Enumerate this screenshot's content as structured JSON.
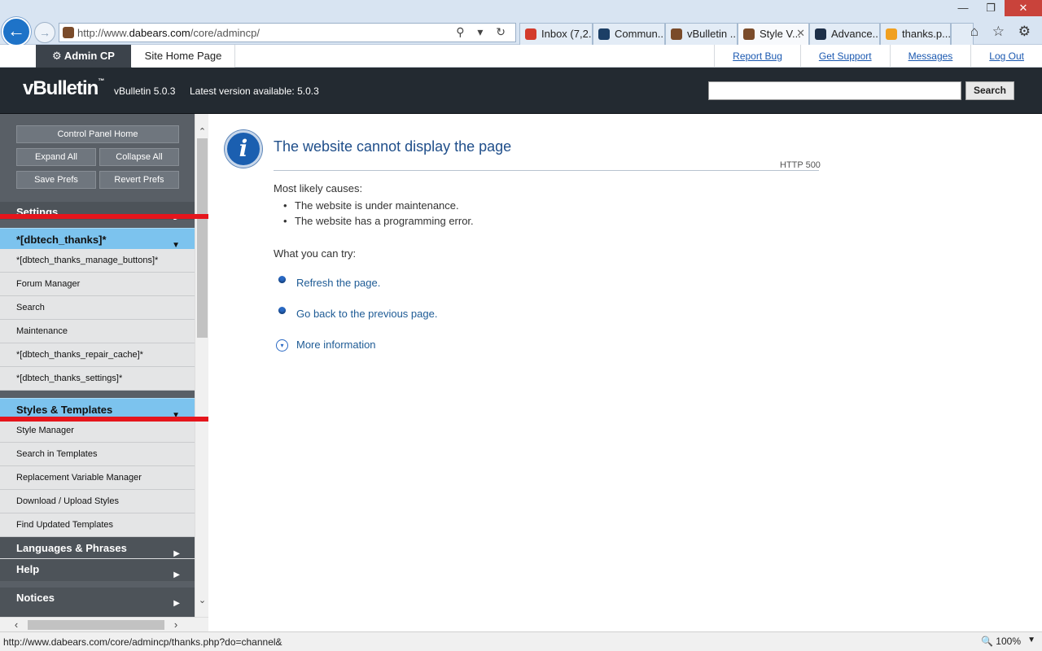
{
  "browser": {
    "url_prefix": "http://www.",
    "url_domain": "dabears.com",
    "url_path": "/core/admincp/",
    "tabs": [
      {
        "label": "Inbox (7,2...",
        "active": false,
        "icon_color": "#d33b2c"
      },
      {
        "label": "Commun...",
        "active": false,
        "icon_color": "#1c3f66"
      },
      {
        "label": "vBulletin ...",
        "active": false,
        "icon_color": "#7a4b2a"
      },
      {
        "label": "Style V...",
        "active": true,
        "icon_color": "#7a4b2a"
      },
      {
        "label": "Advance...",
        "active": false,
        "icon_color": "#1d2f48"
      },
      {
        "label": "thanks.p...",
        "active": false,
        "icon_color": "#f0a020"
      }
    ],
    "close_glyph": "✕",
    "back_glyph": "←",
    "fwd_glyph": "→",
    "address_tools": "⚲ ▾ ↻",
    "chrome_icons": "⌂ ☆ ⚙",
    "window_buttons": {
      "minimize": "—",
      "restore": "❐",
      "close": "✕"
    }
  },
  "topbar": {
    "admin_tab": "Admin CP",
    "admin_icon": "⚙",
    "site_tab": "Site Home Page",
    "links": [
      "Report Bug",
      "Get Support",
      "Messages",
      "Log Out"
    ]
  },
  "header": {
    "logo": "vBulletin",
    "logo_mark": "™",
    "version": "vBulletin 5.0.3",
    "latest": "Latest version available: 5.0.3",
    "search_button": "Search",
    "search_value": ""
  },
  "sidebar": {
    "buttons": {
      "home": "Control Panel Home",
      "expand": "Expand All",
      "collapse": "Collapse All",
      "save": "Save Prefs",
      "revert": "Revert Prefs"
    },
    "settings_group": "Settings",
    "thanks_group": "*[dbtech_thanks]*",
    "thanks_items": [
      "*[dbtech_thanks_manage_buttons]*",
      "Forum Manager",
      "Search",
      "Maintenance",
      "*[dbtech_thanks_repair_cache]*",
      "*[dbtech_thanks_settings]*"
    ],
    "styles_group": "Styles & Templates",
    "styles_items": [
      "Style Manager",
      "Search in Templates",
      "Replacement Variable Manager",
      "Download / Upload Styles",
      "Find Updated Templates"
    ],
    "languages_group": "Languages & Phrases",
    "help_group": "Help",
    "notices_group": "Notices",
    "arrow_right": "▶",
    "arrow_down": "▼"
  },
  "error": {
    "icon_glyph": "i",
    "title": "The website cannot display the page",
    "code": "HTTP 500",
    "causes_heading": "Most likely causes:",
    "causes": [
      "The website is under maintenance.",
      "The website has a programming error."
    ],
    "try_heading": "What you can try:",
    "refresh": "Refresh the page.",
    "back": "Go back to the previous page.",
    "more": "More information",
    "more_glyph": "▾"
  },
  "scroll": {
    "up": "⌃",
    "down": "⌄",
    "left": "‹",
    "right": "›"
  },
  "status": {
    "url": "http://www.dabears.com/core/admincp/thanks.php?do=channel&",
    "zoom": "🔍 100%",
    "zoom_arrow": "▼"
  }
}
